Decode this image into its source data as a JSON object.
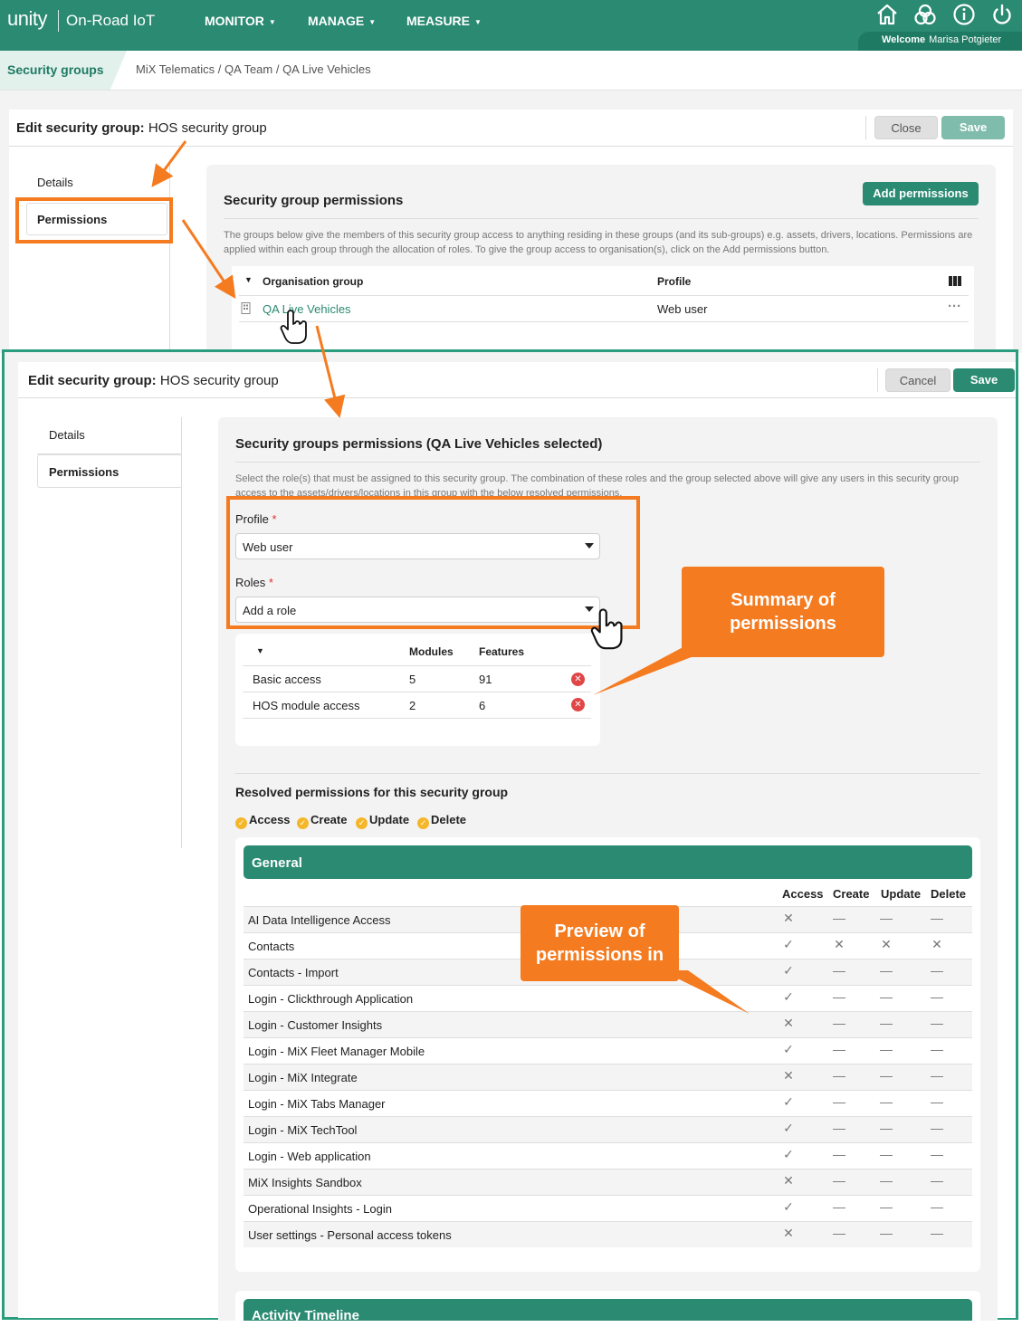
{
  "topbar": {
    "logo": "unity",
    "app_name": "On-Road IoT",
    "nav": [
      {
        "label": "MONITOR"
      },
      {
        "label": "MANAGE"
      },
      {
        "label": "MEASURE"
      }
    ],
    "icons": [
      "home-icon",
      "hub-icon",
      "info-icon",
      "power-icon"
    ],
    "welcome_label": "Welcome",
    "user_name": "Marisa Potgieter"
  },
  "breadcrumb": {
    "tab": "Security groups",
    "path": "MiX Telematics / QA Team / QA Live Vehicles"
  },
  "panel1": {
    "title_label": "Edit security group:",
    "title_value": "HOS security group",
    "close_label": "Close",
    "save_label": "Save",
    "side": {
      "details": "Details",
      "permissions": "Permissions"
    },
    "section_title": "Security group permissions",
    "add_permissions": "Add permissions",
    "description": "The groups below give the members of this security group access to anything residing in these groups (and its sub-groups) e.g. assets, drivers, locations. Permissions are applied within each group through the allocation of roles. To give the group access to organisation(s), click on the Add permissions button.",
    "col_org": "Organisation group",
    "col_profile": "Profile",
    "row_org": "QA Live Vehicles",
    "row_profile": "Web user",
    "row_more": "···"
  },
  "panel2": {
    "title_label": "Edit security group:",
    "title_value": "HOS security group",
    "cancel_label": "Cancel",
    "save_label": "Save",
    "side": {
      "details": "Details",
      "permissions": "Permissions"
    },
    "section_title": "Security groups permissions (QA Live Vehicles selected)",
    "description": "Select the role(s) that must be assigned to this security group. The combination of these roles and the group selected above will give any users in this security group access to the assets/drivers/locations in this group with the below resolved permissions.",
    "profile_label": "Profile",
    "profile_value": "Web user",
    "roles_label": "Roles",
    "roles_placeholder": "Add a role",
    "roles_table": {
      "col_modules": "Modules",
      "col_features": "Features",
      "rows": [
        {
          "name": "Basic access",
          "modules": "5",
          "features": "91"
        },
        {
          "name": "HOS module access",
          "modules": "2",
          "features": "6"
        }
      ]
    },
    "resolved_title": "Resolved permissions for this security group",
    "legend": [
      "Access",
      "Create",
      "Update",
      "Delete"
    ],
    "general_header": "General",
    "perm_cols": [
      "Access",
      "Create",
      "Update",
      "Delete"
    ],
    "permissions": [
      {
        "name": "AI Data Intelligence Access",
        "v": [
          "✕",
          "—",
          "—",
          "—"
        ]
      },
      {
        "name": "Contacts",
        "v": [
          "✓",
          "✕",
          "✕",
          "✕"
        ]
      },
      {
        "name": "Contacts - Import",
        "v": [
          "✓",
          "—",
          "—",
          "—"
        ]
      },
      {
        "name": "Login - Clickthrough Application",
        "v": [
          "✓",
          "—",
          "—",
          "—"
        ]
      },
      {
        "name": "Login - Customer Insights",
        "v": [
          "✕",
          "—",
          "—",
          "—"
        ]
      },
      {
        "name": "Login - MiX Fleet Manager Mobile",
        "v": [
          "✓",
          "—",
          "—",
          "—"
        ]
      },
      {
        "name": "Login - MiX Integrate",
        "v": [
          "✕",
          "—",
          "—",
          "—"
        ]
      },
      {
        "name": "Login - MiX Tabs Manager",
        "v": [
          "✓",
          "—",
          "—",
          "—"
        ]
      },
      {
        "name": "Login - MiX TechTool",
        "v": [
          "✓",
          "—",
          "—",
          "—"
        ]
      },
      {
        "name": "Login - Web application",
        "v": [
          "✓",
          "—",
          "—",
          "—"
        ]
      },
      {
        "name": "MiX Insights Sandbox",
        "v": [
          "✕",
          "—",
          "—",
          "—"
        ]
      },
      {
        "name": "Operational Insights - Login",
        "v": [
          "✓",
          "—",
          "—",
          "—"
        ]
      },
      {
        "name": "User settings - Personal access tokens",
        "v": [
          "✕",
          "—",
          "—",
          "—"
        ]
      }
    ],
    "activity_header": "Activity Timeline"
  },
  "annotations": {
    "callout_summary": "Summary  of permissions",
    "callout_preview": "Preview of permissions in",
    "accent": "#f47b20"
  },
  "colors": {
    "brand": "#2a8a72",
    "frame": "#2a9d7f",
    "danger": "#e04646",
    "legend": "#f5b629"
  }
}
